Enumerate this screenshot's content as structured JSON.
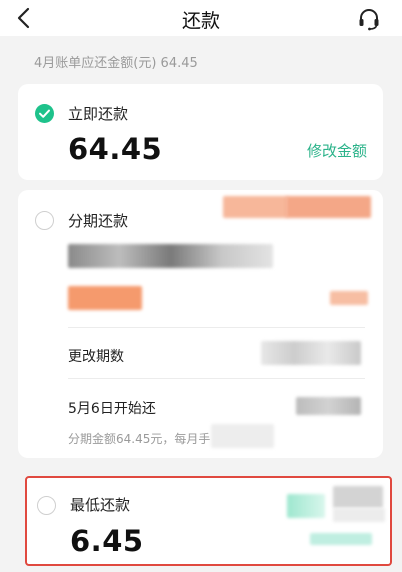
{
  "header": {
    "title": "还款",
    "back_icon": "chevron-left-icon",
    "support_icon": "headset-icon"
  },
  "bill_summary": "4月账单应还金额(元) 64.45",
  "options": {
    "immediate": {
      "label": "立即还款",
      "amount": "64.45",
      "edit_label": "修改金额",
      "selected": true
    },
    "installment": {
      "label": "分期还款",
      "selected": false,
      "change_periods_label": "更改期数",
      "start_date_label": "5月6日开始还",
      "note": "分期金额64.45元，每月手"
    },
    "minimum": {
      "label": "最低还款",
      "amount": "6.45",
      "selected": false
    }
  },
  "colors": {
    "accent_green": "#1ec28b",
    "link_green": "#2bb38a",
    "highlight_red": "#e0493f"
  }
}
